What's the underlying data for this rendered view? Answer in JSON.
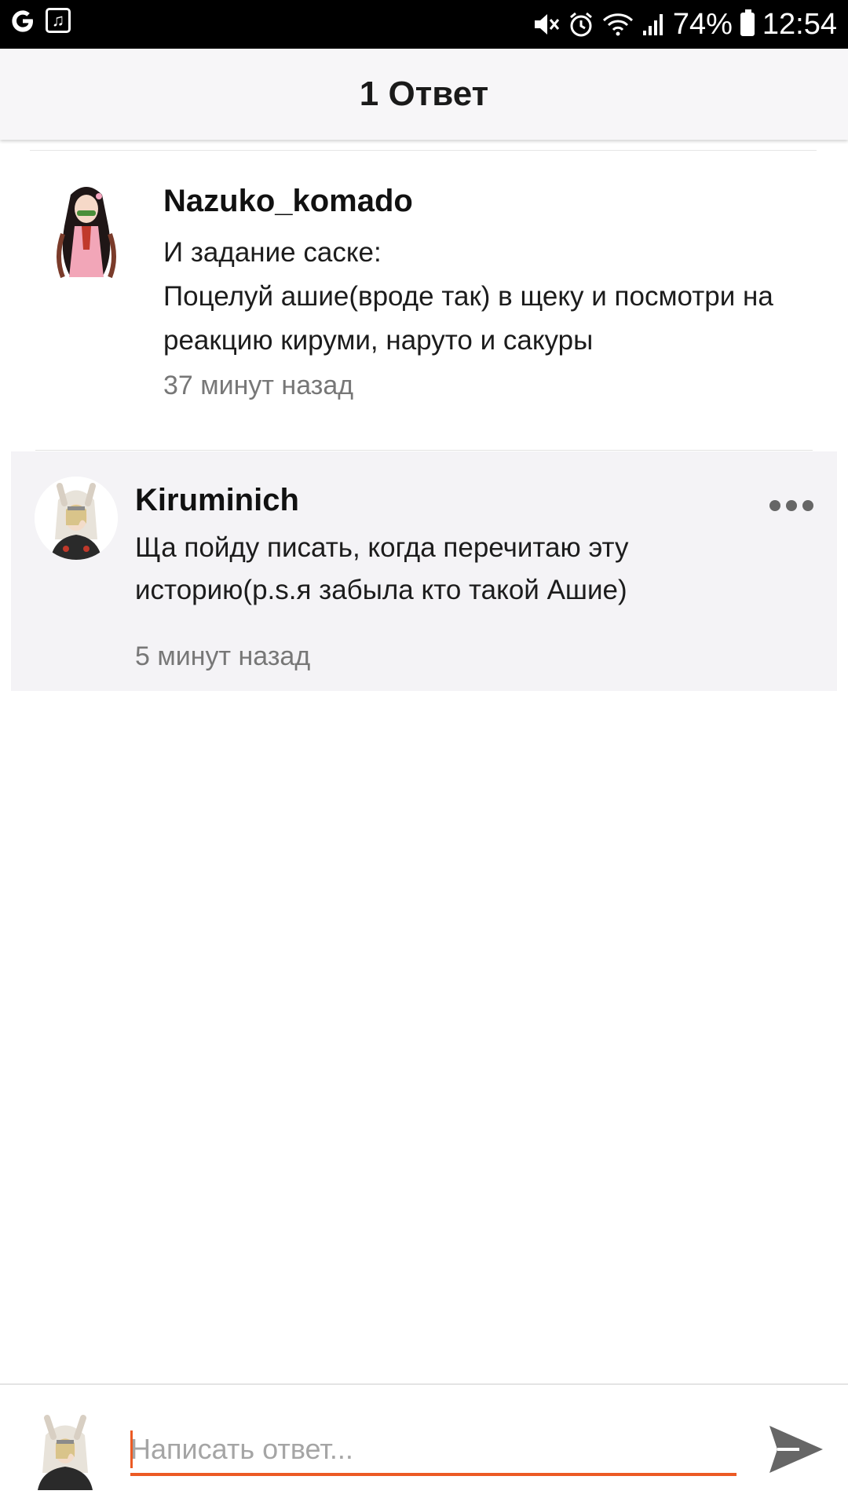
{
  "status_bar": {
    "battery": "74%",
    "time": "12:54"
  },
  "header": {
    "title": "1 Ответ"
  },
  "parent_comment": {
    "author": "Nazuko_komado",
    "lines": [
      "И задание саске:",
      "Поцелуй ашие(вроде так) в щеку и посмотри на",
      "реакцию кируми, наруто и сакуры"
    ],
    "time": "37 минут назад"
  },
  "reply_comment": {
    "author": "Kiruminich",
    "lines": [
      "Ща пойду писать, когда перечитаю эту",
      "историю(p.s.я забыла кто такой Ашие)"
    ],
    "time": "5 минут назад"
  },
  "composer": {
    "placeholder": "Написать ответ..."
  },
  "colors": {
    "accent": "#ec5a24",
    "header_bg": "#f7f6f8",
    "reply_bg": "#f4f3f6"
  },
  "icons": {
    "status_left": [
      "google-icon",
      "music-icon"
    ],
    "status_right": [
      "mute-icon",
      "alarm-icon",
      "wifi-icon",
      "signal-icon",
      "battery-icon"
    ],
    "more": "more-dots-icon",
    "send": "send-icon"
  }
}
